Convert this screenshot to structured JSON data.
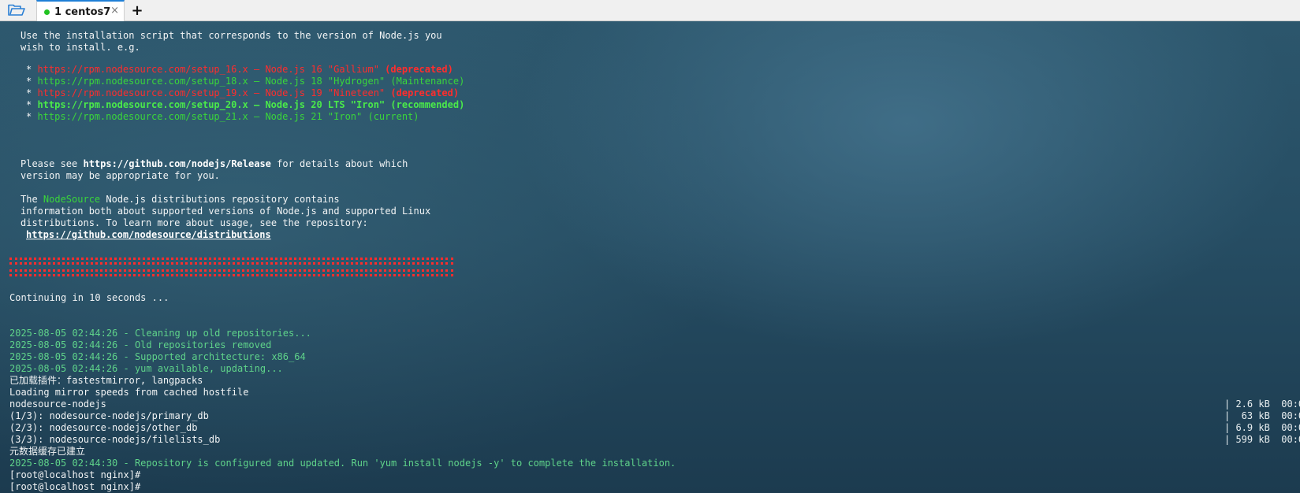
{
  "tabbar": {
    "folder_icon": "folder-open-icon",
    "tab_label": "1 centos7",
    "tab_status_color": "#22c322",
    "tab_close": "×",
    "new_tab": "+"
  },
  "terminal": {
    "intro1": "Use the installation script that corresponds to the version of Node.js you",
    "intro2": "wish to install. e.g.",
    "setup": [
      {
        "bullet": "* ",
        "url": "https://rpm.nodesource.com/setup_16.x",
        "desc": " — Node.js 16 \"Gallium\" ",
        "tag": "(deprecated)"
      },
      {
        "bullet": "* ",
        "url": "https://rpm.nodesource.com/setup_18.x",
        "desc": " — Node.js 18 \"Hydrogen\" ",
        "tag": "(Maintenance)"
      },
      {
        "bullet": "* ",
        "url": "https://rpm.nodesource.com/setup_19.x",
        "desc": " — Node.js 19 \"Nineteen\" ",
        "tag": "(deprecated)"
      },
      {
        "bullet": "* ",
        "url": "https://rpm.nodesource.com/setup_20.x",
        "desc": " — Node.js 20 LTS \"Iron\" ",
        "tag": "(recommended)"
      },
      {
        "bullet": "* ",
        "url": "https://rpm.nodesource.com/setup_21.x",
        "desc": " — Node.js 21 \"Iron\" ",
        "tag": "(current)"
      }
    ],
    "please_a": "Please see ",
    "please_link": "https://github.com/nodejs/Release",
    "please_b": " for details about which",
    "please2": "version may be appropriate for you.",
    "ns_a": "The ",
    "ns_name": "NodeSource",
    "ns_b": " Node.js distributions repository contains",
    "ns2": "information both about supported versions of Node.js and supported Linux",
    "ns3": "distributions. To learn more about usage, see the repository:",
    "ns_link": "https://github.com/nodesource/distributions",
    "continuing": "Continuing in 10 seconds ...",
    "log": [
      "2025-08-05 02:44:26 - Cleaning up old repositories...",
      "2025-08-05 02:44:26 - Old repositories removed",
      "2025-08-05 02:44:26 - Supported architecture: x86_64",
      "2025-08-05 02:44:26 - yum available, updating..."
    ],
    "plugins": "已加载插件：fastestmirror, langpacks",
    "mirror": "Loading mirror speeds from cached hostfile",
    "repos": [
      {
        "name": "nodesource-nodejs",
        "size": "| 2.6 kB  00:0"
      },
      {
        "name": "(1/3): nodesource-nodejs/primary_db",
        "size": "|  63 kB  00:0"
      },
      {
        "name": "(2/3): nodesource-nodejs/other_db",
        "size": "| 6.9 kB  00:0"
      },
      {
        "name": "(3/3): nodesource-nodejs/filelists_db",
        "size": "| 599 kB  00:0"
      }
    ],
    "cache_built": "元数据缓存已建立",
    "configured": "2025-08-05 02:44:30 - Repository is configured and updated. Run 'yum install nodejs -y' to complete the installation.",
    "prompts": [
      "[root@localhost nginx]#",
      "[root@localhost nginx]#"
    ]
  }
}
